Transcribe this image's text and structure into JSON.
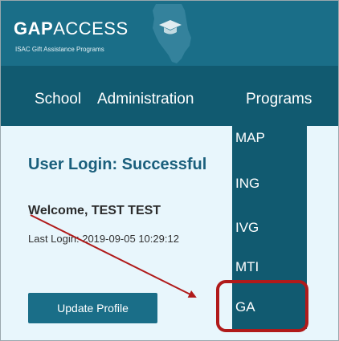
{
  "logo": {
    "gap": "GAP",
    "access": "ACCESS",
    "subtitle": "ISAC Gift Assistance Programs"
  },
  "nav": {
    "items": [
      {
        "label": "School"
      },
      {
        "label": "Administration"
      },
      {
        "label": "Programs"
      }
    ]
  },
  "main": {
    "title": "User Login: Successful",
    "welcome": "Welcome, TEST TEST",
    "last_login": "Last Login: 2019-09-05 10:29:12",
    "update_profile_label": "Update Profile"
  },
  "programs_menu": {
    "items": [
      {
        "label": "MAP"
      },
      {
        "label": "ING"
      },
      {
        "label": "IVG"
      },
      {
        "label": "MTI"
      },
      {
        "label": "GA"
      }
    ],
    "highlighted": "GA"
  },
  "colors": {
    "header": "#1a6e88",
    "nav": "#115a70",
    "content_bg": "#e8f6fc",
    "title": "#1a5f7c",
    "annotation": "#b01a1a"
  },
  "icons": {
    "logo_mark": "illinois-state-icon",
    "logo_cap": "graduation-cap-icon",
    "annotation": "arrow-icon"
  }
}
